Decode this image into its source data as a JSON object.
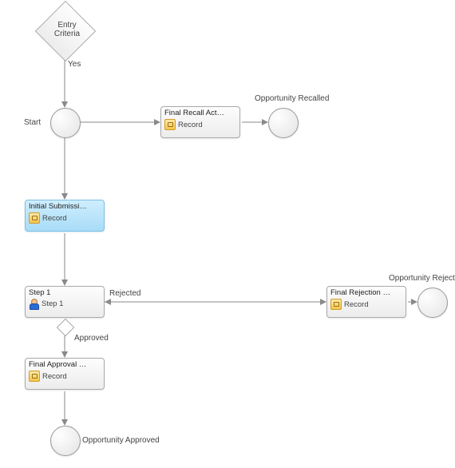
{
  "diamond_entry": {
    "label": "Entry Criteria"
  },
  "edge_labels": {
    "yes": "Yes",
    "start": "Start",
    "rejected": "Rejected",
    "approved": "Approved"
  },
  "circles": {
    "start": {},
    "recalled": {
      "label": "Opportunity Recalled"
    },
    "rejected": {
      "label": "Opportunity Rejected"
    },
    "approved": {
      "label": "Opportunity Approved"
    }
  },
  "nodes": {
    "recall": {
      "title": "Final Recall Act…",
      "sub": "Record",
      "icon": "lock"
    },
    "initial": {
      "title": "Initial Submissi…",
      "sub": "Record",
      "icon": "lock"
    },
    "step1": {
      "title": "Step 1",
      "sub": "Step 1",
      "icon": "user"
    },
    "rejection": {
      "title": "Final Rejection …",
      "sub": "Record",
      "icon": "lock"
    },
    "approval": {
      "title": "Final Approval …",
      "sub": "Record",
      "icon": "lock"
    }
  }
}
